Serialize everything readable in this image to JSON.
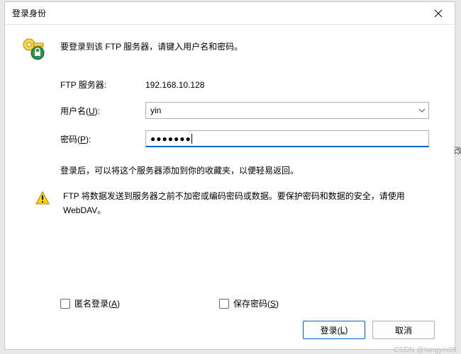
{
  "titlebar": {
    "title": "登录身份"
  },
  "intro": {
    "text": "要登录到该 FTP 服务器，请键入用户名和密码。"
  },
  "fields": {
    "server_label": "FTP 服务器:",
    "server_value": "192.168.10.128",
    "username_label_pre": "用户名(",
    "username_label_key": "U",
    "username_label_post": "):",
    "username_value": "yin",
    "password_label_pre": "密码(",
    "password_label_key": "P",
    "password_label_post": "):",
    "password_value": "●●●●●●●"
  },
  "hint": {
    "text": "登录后，可以将这个服务器添加到你的收藏夹，以便轻易返回。"
  },
  "warning": {
    "text": "FTP 将数据发送到服务器之前不加密或编码密码或数据。要保护密码和数据的安全，请使用 WebDAV。"
  },
  "checkboxes": {
    "anonymous_pre": "匿名登录(",
    "anonymous_key": "A",
    "anonymous_post": ")",
    "save_pre": "保存密码(",
    "save_key": "S",
    "save_post": ")"
  },
  "buttons": {
    "login_pre": "登录(",
    "login_key": "L",
    "login_post": ")",
    "cancel": "取消"
  },
  "watermark": "CSDN @tangyin09",
  "side_char": "改"
}
